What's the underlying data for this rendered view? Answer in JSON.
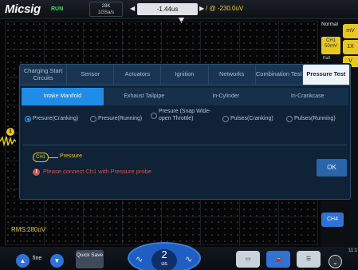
{
  "topbar": {
    "brand": "Micsig",
    "run_state": "RUN",
    "memory": "28K",
    "sample_rate": "1GSa/s",
    "timebase": "-1.44us",
    "trigger": "/ @ -230.0uV"
  },
  "side": {
    "mode": "Normal",
    "ch1_label": "CH1",
    "ch1_scale": "50mV",
    "ch1_full": "Full",
    "tab_mv": "mV",
    "tab_1x": "1X",
    "tab_v": "V",
    "ch4_label": "CH4",
    "clock": "11:1"
  },
  "waveform": {
    "channel_marker": "1",
    "rms": "RMS:280uV"
  },
  "dialog": {
    "tabs": [
      {
        "label": "Charging Start Circuits",
        "active": false
      },
      {
        "label": "Sensor",
        "active": false
      },
      {
        "label": "Actuators",
        "active": false
      },
      {
        "label": "Ignition",
        "active": false
      },
      {
        "label": "Networks",
        "active": false
      },
      {
        "label": "Combination Test",
        "active": false
      },
      {
        "label": "Pressure Test",
        "active": true
      }
    ],
    "subtabs": [
      {
        "label": "Intake Manifold",
        "active": true
      },
      {
        "label": "Exhaust Tailpipe",
        "active": false
      },
      {
        "label": "In-Cylinder",
        "active": false
      },
      {
        "label": "In-Crankcase",
        "active": false
      }
    ],
    "options": [
      {
        "label": "Presure(Cranking)",
        "selected": true
      },
      {
        "label": "Presure(Running)",
        "selected": false
      },
      {
        "label": "Presure (Snap Wide-open Throttle)",
        "selected": false
      },
      {
        "label": "Pulses(Cranking)",
        "selected": false
      },
      {
        "label": "Pulses(Running)",
        "selected": false
      }
    ],
    "probe": {
      "channel": "CH1",
      "label": "Pressure"
    },
    "warning": "Please connect Ch1 with Pressure probe",
    "ok_label": "OK"
  },
  "bottombar": {
    "fine_label": "fine",
    "quick_save": "Quick Save",
    "knob_value": "2",
    "knob_unit": "us"
  },
  "colors": {
    "ch1": "#e8c81e",
    "accent": "#1f8ce6",
    "warning": "#d8534e"
  }
}
